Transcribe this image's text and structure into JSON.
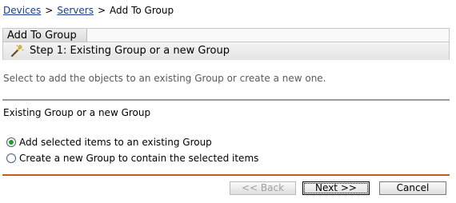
{
  "breadcrumb": {
    "items": [
      {
        "label": "Devices"
      },
      {
        "label": "Servers"
      }
    ],
    "separator": ">",
    "current": "Add To Group"
  },
  "panel": {
    "tab_label": "Add To Group",
    "step_title": "Step 1: Existing Group or a new Group",
    "step_icon": "wand-icon"
  },
  "instruction": "Select to add the objects to an existing Group or create a new one.",
  "section_label": "Existing Group or a new Group",
  "options": [
    {
      "label": "Add selected items to an existing Group",
      "selected": true
    },
    {
      "label": "Create a new Group to contain the selected items",
      "selected": false
    }
  ],
  "buttons": {
    "back": "<< Back",
    "next": "Next >>",
    "cancel": "Cancel"
  },
  "colors": {
    "link": "#1a3d8f",
    "radio_selected": "#21a121",
    "footer_divider": "#c45a1e",
    "section_divider": "#9a9a9a"
  }
}
